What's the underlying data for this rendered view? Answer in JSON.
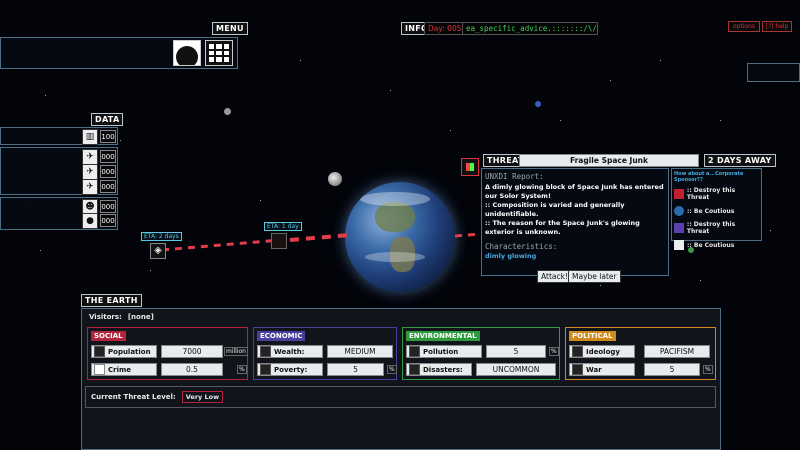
{
  "menu": {
    "label": "MENU"
  },
  "info": {
    "label": "INFO",
    "day": "Day: 005",
    "advice": "ea_specific_advice.:::::::/\\/"
  },
  "topright": {
    "options": "options",
    "help": "[?] help"
  },
  "data_panel": {
    "label": "DATA",
    "rows": [
      {
        "icon": "bar-chart-icon",
        "value": "100"
      },
      {
        "icon": "ship-icon",
        "value": "000"
      },
      {
        "icon": "ship-icon",
        "value": "000"
      },
      {
        "icon": "ship-icon",
        "value": "000"
      },
      {
        "icon": "people-icon",
        "value": "000"
      },
      {
        "icon": "person-icon",
        "value": "000"
      }
    ]
  },
  "eta": {
    "left": "ETA: 2 days",
    "mid": "ETA: 1 day"
  },
  "threat": {
    "label": "THREAT",
    "name": "Fragile Space Junk",
    "time": "2 DAYS AWAY",
    "report_title": "UNXDI Report:",
    "report_lines": [
      "Δ dimly glowing block of Space Junk has entered our Solor System!",
      ":: Composition is varied and generally unidentifiable.",
      ":: The reason for the Space Junk's glowing exterior is unknown."
    ],
    "char_title": "Characteristics:",
    "char_value": "dimly glowing",
    "attack_btn": "Attack!",
    "maybe_btn": "Maybe later"
  },
  "advice": {
    "title": "How about a...Corporate Sponsor??",
    "items": [
      {
        "icon": "corp-logo-icon",
        "text": ":: Destroy this Threat"
      },
      {
        "icon": "globe-logo-icon",
        "text": ":: Be Coutious"
      },
      {
        "icon": "corp-grid-icon",
        "text": ":: Destroy this Threat"
      },
      {
        "icon": "corp-badge-icon",
        "text": ":: Be Coutious"
      }
    ]
  },
  "earth": {
    "label": "THE EARTH",
    "visitors_label": "Visitors:",
    "visitors_value": "[none]",
    "categories": [
      {
        "name": "SOCIAL",
        "color": "#b3243a",
        "rows": [
          {
            "label": "Population",
            "value": "7000",
            "unit": "million"
          },
          {
            "label": "Crime",
            "value": "0.5",
            "unit": "%"
          }
        ]
      },
      {
        "name": "ECONOMIC",
        "color": "#4a3fa0",
        "rows": [
          {
            "label": "Wealth:",
            "value": "MEDIUM",
            "unit": ""
          },
          {
            "label": "Poverty:",
            "value": "5",
            "unit": "%"
          }
        ]
      },
      {
        "name": "ENVIRONMENTAL",
        "color": "#2f9a3e",
        "rows": [
          {
            "label": "Pollution",
            "value": "5",
            "unit": "%"
          },
          {
            "label": "Disasters:",
            "value": "UNCOMMON",
            "unit": ""
          }
        ]
      },
      {
        "name": "POLITICAL",
        "color": "#d08a1c",
        "rows": [
          {
            "label": "Ideology",
            "value": "PACIFISM",
            "unit": ""
          },
          {
            "label": "War",
            "value": "5",
            "unit": "%"
          }
        ]
      }
    ],
    "threat_level_label": "Current Threat Level:",
    "threat_level_value": "Very Low"
  }
}
